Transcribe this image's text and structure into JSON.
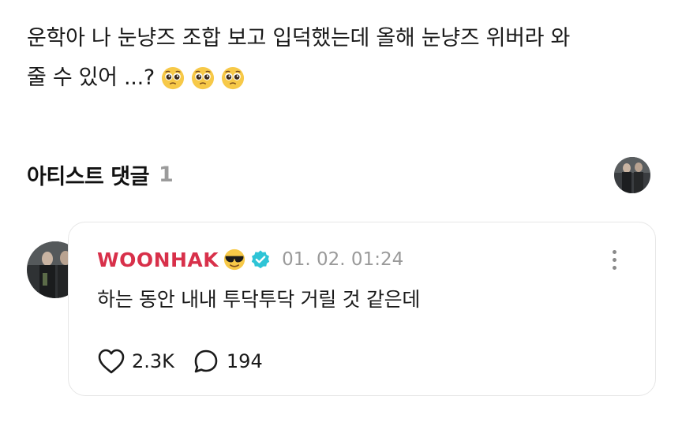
{
  "post": {
    "line1": "운학아 나 눈냥즈 조합 보고 입덕했는데 올해 눈냥즈 위버라 와",
    "line2": "줄 수 있어 ...?",
    "emojis": [
      "pleading-face",
      "pleading-face",
      "pleading-face"
    ]
  },
  "artist_comments": {
    "title": "아티스트 댓글",
    "count": "1"
  },
  "comment": {
    "author": "WOONHAK",
    "author_emoji": "sunglasses-face",
    "verified": true,
    "timestamp": "01. 02. 01:24",
    "body": "하는 동안 내내 투닥투닥 거릴 것 같은데",
    "likes": "2.3K",
    "replies": "194"
  },
  "colors": {
    "author": "#d8304a",
    "verified": "#2ec4d6",
    "muted": "#9a9a9a",
    "card_border": "#e6e6e6"
  }
}
